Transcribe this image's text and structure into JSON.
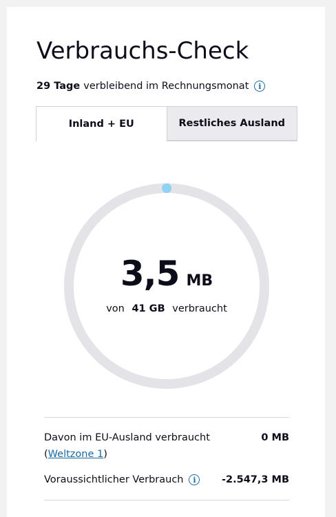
{
  "header": {
    "title": "Verbrauchs-Check",
    "remaining_days": "29 Tage",
    "remaining_text": "verbleibend im Rechnungsmonat"
  },
  "tabs": [
    {
      "label": "Inland + EU",
      "active": true
    },
    {
      "label": "Restliches Ausland",
      "active": false
    }
  ],
  "usage": {
    "used_value": "3,5",
    "used_unit": "MB",
    "of_prefix": "von",
    "total": "41 GB",
    "of_suffix": "verbraucht",
    "progress_fraction": 0.0001,
    "ring_color": "#e3e3e8",
    "progress_color": "#8fd3f4"
  },
  "details": {
    "eu_label_prefix": "Davon im EU-Ausland verbraucht (",
    "eu_link_text": "Weltzone 1",
    "eu_label_suffix": ")",
    "eu_value": "0 MB",
    "forecast_label": "Voraussichtlicher Verbrauch",
    "forecast_value": "-2.547,3 MB"
  },
  "colors": {
    "accent": "#1b6aa5",
    "text": "#0d0d1a"
  },
  "icons": {
    "info": "info-icon"
  }
}
